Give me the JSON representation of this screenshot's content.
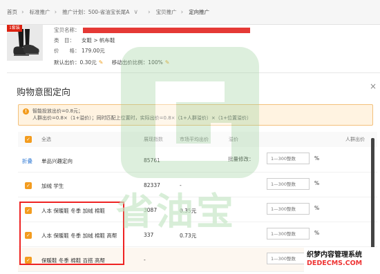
{
  "breadcrumb": [
    {
      "label": "首页"
    },
    {
      "label": "标准推广"
    },
    {
      "label": "推广计划：500-省油宝长尾A"
    },
    {
      "label": "宝贝推广"
    },
    {
      "label": "定向推广"
    }
  ],
  "product": {
    "badge": "1套装",
    "name_label": "宝贝名称：",
    "category_label": "类　目：",
    "category": "女鞋 > 帆布鞋",
    "price_label": "价　　格：",
    "price": "179.00元",
    "default_bid_label": "默认出价：",
    "default_bid": "0.30元",
    "mobile_ratio_label": "移动出价比例：",
    "mobile_ratio": "100%"
  },
  "panel": {
    "title": "购物意图定向",
    "close": "×",
    "alert_line1": "智能投放出价=0.8元；",
    "alert_line2": "人群出价=0.8×（1+溢价）；同时匹配上位置时，实际出价=0.8×（1+人群溢价）×（1+位置溢价）"
  },
  "table": {
    "headers": {
      "select_all": "全选",
      "index": "展现指数",
      "avg_bid": "市场平均出价",
      "premium": "溢价",
      "crowd_bid": "人群出价"
    },
    "fold": "折叠",
    "batch_label": "批量修改：",
    "rows": [
      {
        "keyword": "单品兴趣定向",
        "index": "85761",
        "avg": "",
        "checked": false
      },
      {
        "keyword": "加绒 学生",
        "index": "82337",
        "avg": "-",
        "checked": true
      },
      {
        "keyword": "人本 保暖鞋 冬季 加绒 棉鞋",
        "index": "3087",
        "avg": "0.35元",
        "checked": true
      },
      {
        "keyword": "人本 保暖鞋 冬季 加绒 棉鞋 高帮",
        "index": "337",
        "avg": "0.73元",
        "checked": true
      },
      {
        "keyword": "保暖鞋 冬季 棉鞋 百搭 高帮",
        "index": "-",
        "avg": "",
        "checked": true
      }
    ],
    "input_placeholder": "1—300整数",
    "pct": "%"
  },
  "watermark": {
    "text": "省油宝",
    "site_line1": "织梦内容管理系统",
    "site_line2": "DEDECMS.COM"
  },
  "colors": {
    "accent": "#f39c1f",
    "highlight_box": "#e22222",
    "link": "#1f6fd1"
  }
}
